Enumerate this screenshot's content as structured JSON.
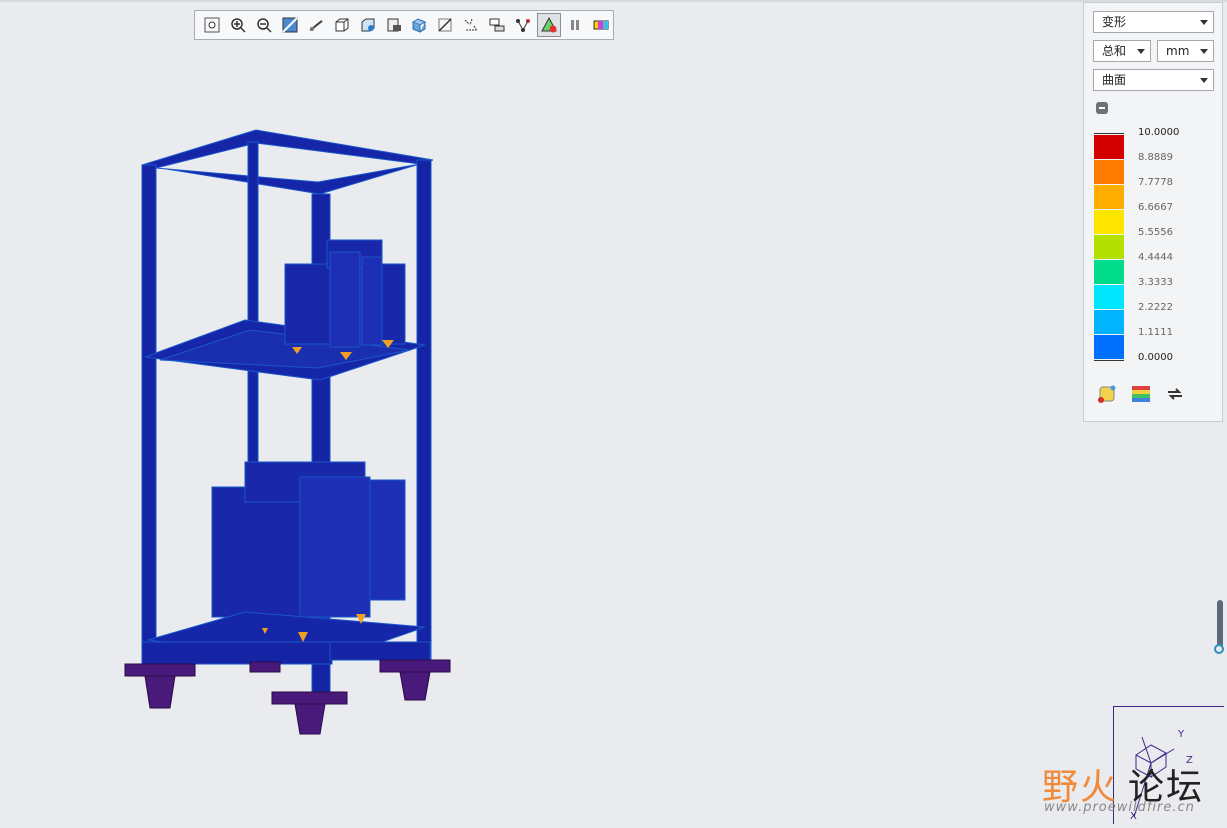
{
  "toolbar": {
    "buttons": [
      {
        "name": "refit-button",
        "icon": "refit-icon"
      },
      {
        "name": "zoom-in-button",
        "icon": "zoom-in-icon"
      },
      {
        "name": "zoom-out-button",
        "icon": "zoom-out-icon"
      },
      {
        "name": "repaint-button",
        "icon": "repaint-icon"
      },
      {
        "name": "pan-zoom-rotate-button",
        "icon": "pan-icon"
      },
      {
        "name": "display-style-button",
        "icon": "display-style-icon"
      },
      {
        "name": "saved-orientations-button",
        "icon": "saved-view-icon"
      },
      {
        "name": "view-manager-button",
        "icon": "view-manager-icon"
      },
      {
        "name": "perspective-button",
        "icon": "perspective-icon"
      },
      {
        "name": "section-button",
        "icon": "section-icon"
      },
      {
        "name": "datum-display-button",
        "icon": "datum-display-icon"
      },
      {
        "name": "annotation-display-button",
        "icon": "annotation-icon"
      },
      {
        "name": "model-tree-button",
        "icon": "tree-icon"
      },
      {
        "name": "animate-button",
        "icon": "animate-icon",
        "active": true
      },
      {
        "name": "pause-button",
        "icon": "pause-icon"
      },
      {
        "name": "legend-colors-button",
        "icon": "legend-icon"
      }
    ]
  },
  "panel": {
    "quantity": "变形",
    "component": "总和",
    "units": "mm",
    "display": "曲面",
    "legend": {
      "ticks": [
        "10.0000",
        "8.8889",
        "7.7778",
        "6.6667",
        "5.5556",
        "4.4444",
        "3.3333",
        "2.2222",
        "1.1111",
        "0.0000"
      ],
      "colors": [
        "#d40000",
        "#ff7a00",
        "#ffae00",
        "#ffe600",
        "#b4e000",
        "#00dc8c",
        "#00e6ff",
        "#00b4ff",
        "#0070ff"
      ]
    },
    "icons": [
      "result-style-icon",
      "color-map-icon",
      "refresh-icon"
    ]
  },
  "watermark": {
    "part1": "野火",
    "part2": "论坛",
    "url": "www.proewildfire.cn"
  },
  "triad": {
    "y_label": "Y",
    "z_label": "Z",
    "x_label": "X"
  }
}
